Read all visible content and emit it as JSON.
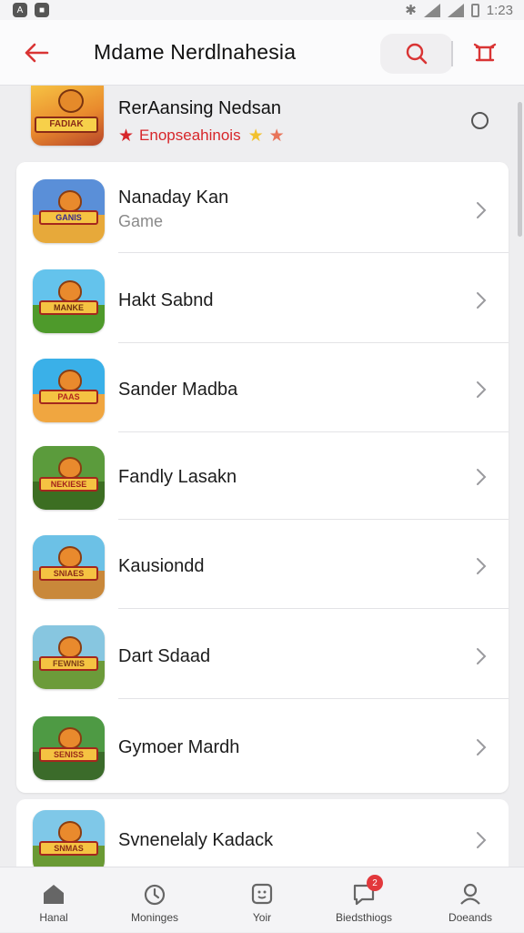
{
  "status_bar": {
    "time": "1:23"
  },
  "app_bar": {
    "title": "Mdame Nerdlnahesia"
  },
  "featured": {
    "title": "RerAansing Nedsan",
    "subtitle": "Enopseahinois",
    "thumb_label": "FADIAK",
    "colors": {
      "accent": "#d7262a",
      "star_red": "#d7262a",
      "star_gold": "#f2c12e",
      "star_orange": "#e8745a"
    }
  },
  "list": [
    {
      "title": "Nanaday Kan",
      "subtitle": "Game",
      "icon_label": "GANIS"
    },
    {
      "title": "Hakt Sabnd",
      "subtitle": "",
      "icon_label": "MANKE"
    },
    {
      "title": "Sander Madba",
      "subtitle": "",
      "icon_label": "PAAS"
    },
    {
      "title": "Fandly Lasakn",
      "subtitle": "",
      "icon_label": "NEKIESE"
    },
    {
      "title": "Kausiondd",
      "subtitle": "",
      "icon_label": "SNIAES"
    },
    {
      "title": "Dart Sdaad",
      "subtitle": "",
      "icon_label": "FEWNIS"
    },
    {
      "title": "Gymoer Mardh",
      "subtitle": "",
      "icon_label": "SENISS"
    }
  ],
  "partial_item": {
    "title": "Svnenelaly Kadack",
    "icon_label": "SNMAS"
  },
  "bottom_nav": [
    {
      "label": "Hanal",
      "icon": "home-icon"
    },
    {
      "label": "Moninges",
      "icon": "clock-icon"
    },
    {
      "label": "Yoir",
      "icon": "smiley-icon"
    },
    {
      "label": "Biedsthiogs",
      "icon": "chat-icon",
      "badge": "2"
    },
    {
      "label": "Doeands",
      "icon": "profile-icon"
    }
  ]
}
